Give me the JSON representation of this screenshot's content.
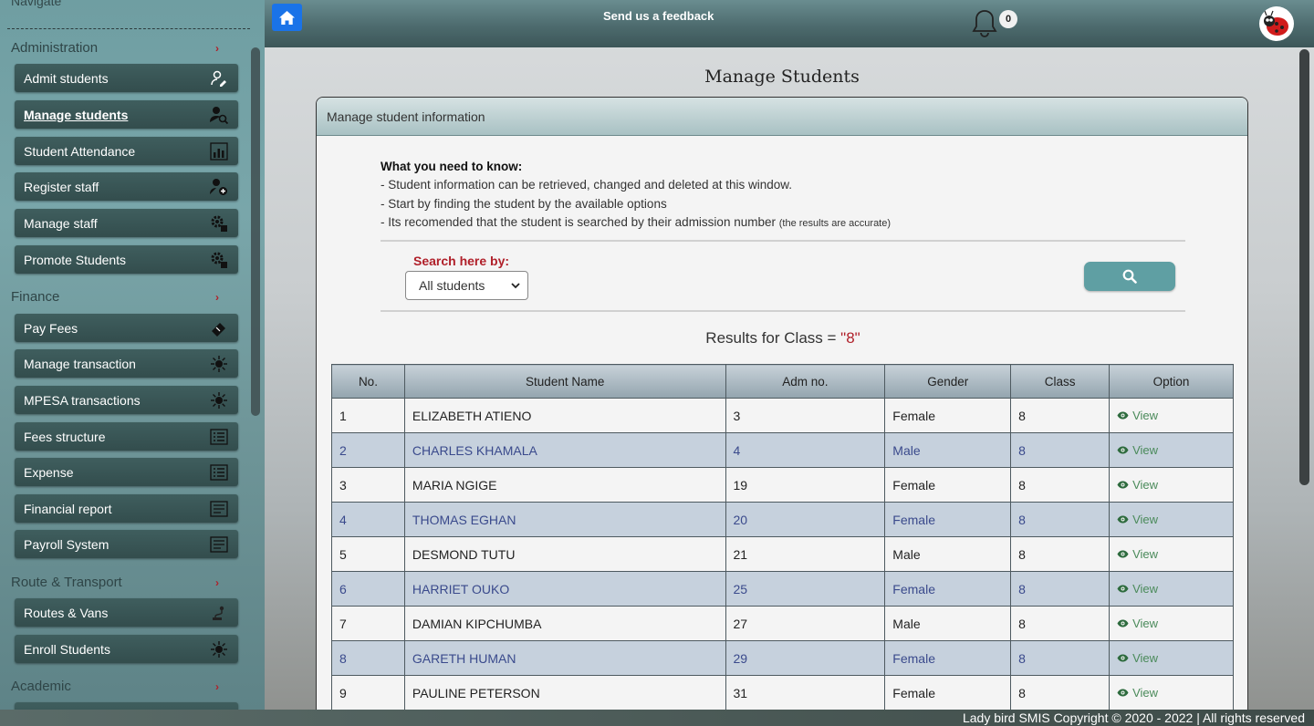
{
  "sidebar": {
    "nav_title": "Navigate",
    "sections": [
      {
        "label": "Administration"
      },
      {
        "label": "Finance"
      },
      {
        "label": "Route & Transport"
      },
      {
        "label": "Academic"
      }
    ],
    "items": [
      {
        "label": "Admit students",
        "icon": "user-edit-icon"
      },
      {
        "label": "Manage students",
        "icon": "user-search-icon"
      },
      {
        "label": "Student Attendance",
        "icon": "chart-icon"
      },
      {
        "label": "Register staff",
        "icon": "user-add-icon"
      },
      {
        "label": "Manage staff",
        "icon": "gear-icon"
      },
      {
        "label": "Promote Students",
        "icon": "gear-icon"
      },
      {
        "label": "Pay Fees",
        "icon": "ticket-icon"
      },
      {
        "label": "Manage transaction",
        "icon": "sun-icon"
      },
      {
        "label": "MPESA transactions",
        "icon": "sun-icon"
      },
      {
        "label": "Fees structure",
        "icon": "table-icon"
      },
      {
        "label": "Expense",
        "icon": "table-icon"
      },
      {
        "label": "Financial report",
        "icon": "list-icon"
      },
      {
        "label": "Payroll System",
        "icon": "list-icon"
      },
      {
        "label": "Routes & Vans",
        "icon": "route-icon"
      },
      {
        "label": "Enroll Students",
        "icon": "sun-icon"
      }
    ]
  },
  "topbar": {
    "feedback": "Send us a feedback",
    "notification_count": "0"
  },
  "page": {
    "title": "Manage Students",
    "card_title": "Manage student information",
    "info_heading": "What you need to know:",
    "info_lines": [
      "- Student information can be retrieved, changed and deleted at this window.",
      "- Start by finding the student by the available options",
      "- Its recomended that the student is searched by their admission number"
    ],
    "info_note": "(the results are accurate)",
    "search_label": "Search here by:",
    "search_selected": "All students",
    "results_prefix": "Results for Class = ",
    "results_value": "\"8\""
  },
  "table": {
    "headers": [
      "No.",
      "Student Name",
      "Adm no.",
      "Gender",
      "Class",
      "Option"
    ],
    "rows": [
      [
        "1",
        "ELIZABETH ATIENO",
        "3",
        "Female",
        "8",
        "View"
      ],
      [
        "2",
        "CHARLES KHAMALA",
        "4",
        "Male",
        "8",
        "View"
      ],
      [
        "3",
        "MARIA NGIGE",
        "19",
        "Female",
        "8",
        "View"
      ],
      [
        "4",
        "THOMAS EGHAN",
        "20",
        "Female",
        "8",
        "View"
      ],
      [
        "5",
        "DESMOND TUTU",
        "21",
        "Male",
        "8",
        "View"
      ],
      [
        "6",
        "HARRIET OUKO",
        "25",
        "Female",
        "8",
        "View"
      ],
      [
        "7",
        "DAMIAN KIPCHUMBA",
        "27",
        "Male",
        "8",
        "View"
      ],
      [
        "8",
        "GARETH HUMAN",
        "29",
        "Female",
        "8",
        "View"
      ],
      [
        "9",
        "PAULINE PETERSON",
        "31",
        "Female",
        "8",
        "View"
      ]
    ]
  },
  "footer": {
    "text": "Lady bird SMIS Copyright © 2020 - 2022 | All rights reserved"
  }
}
